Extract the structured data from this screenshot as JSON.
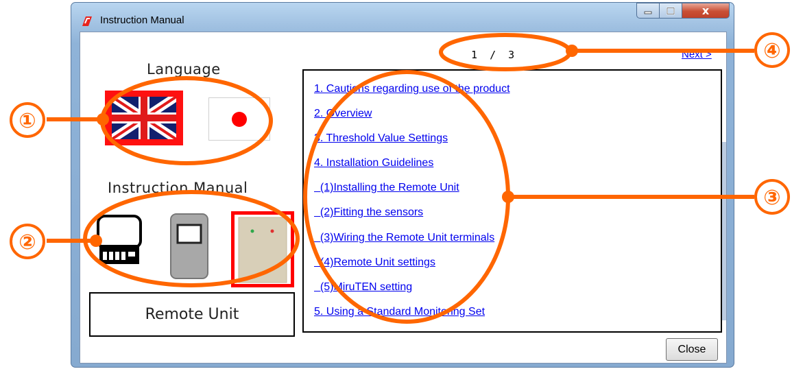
{
  "window": {
    "title": "Instruction Manual",
    "controls": {
      "minimize": "—",
      "maximize": "□",
      "close": "x"
    }
  },
  "left_panel": {
    "language_label": "Language",
    "languages": [
      {
        "name": "English",
        "icon": "uk-flag-icon",
        "selected": true
      },
      {
        "name": "Japanese",
        "icon": "japan-flag-icon",
        "selected": false
      }
    ],
    "manual_label": "Instruction Manual",
    "devices": [
      {
        "icon": "monitor-device-icon",
        "selected": false
      },
      {
        "icon": "sensor-device-icon",
        "selected": false
      },
      {
        "icon": "remote-unit-icon",
        "selected": true
      }
    ],
    "selected_device_label": "Remote Unit"
  },
  "pager": {
    "text": "1  /  3",
    "current": 1,
    "total": 3,
    "next_label": "Next >"
  },
  "toc": {
    "items": [
      "1. Cautions regarding use of the product",
      "2. Overview",
      "3. Threshold Value Settings",
      "4. Installation Guidelines",
      "  (1)Installing the Remote Unit",
      "  (2)Fitting the sensors",
      "  (3)Wiring the Remote Unit terminals",
      "  (4)Remote Unit settings",
      "  (5)MiruTEN setting",
      "5. Using a Standard Monitoring Set"
    ]
  },
  "close_button_label": "Close",
  "annotations": {
    "badges": [
      "①",
      "②",
      "③",
      "④"
    ],
    "color": "#ff6600"
  },
  "colors": {
    "link": "#0000ee",
    "selection_border": "#ff0000",
    "annotation": "#ff6600"
  }
}
